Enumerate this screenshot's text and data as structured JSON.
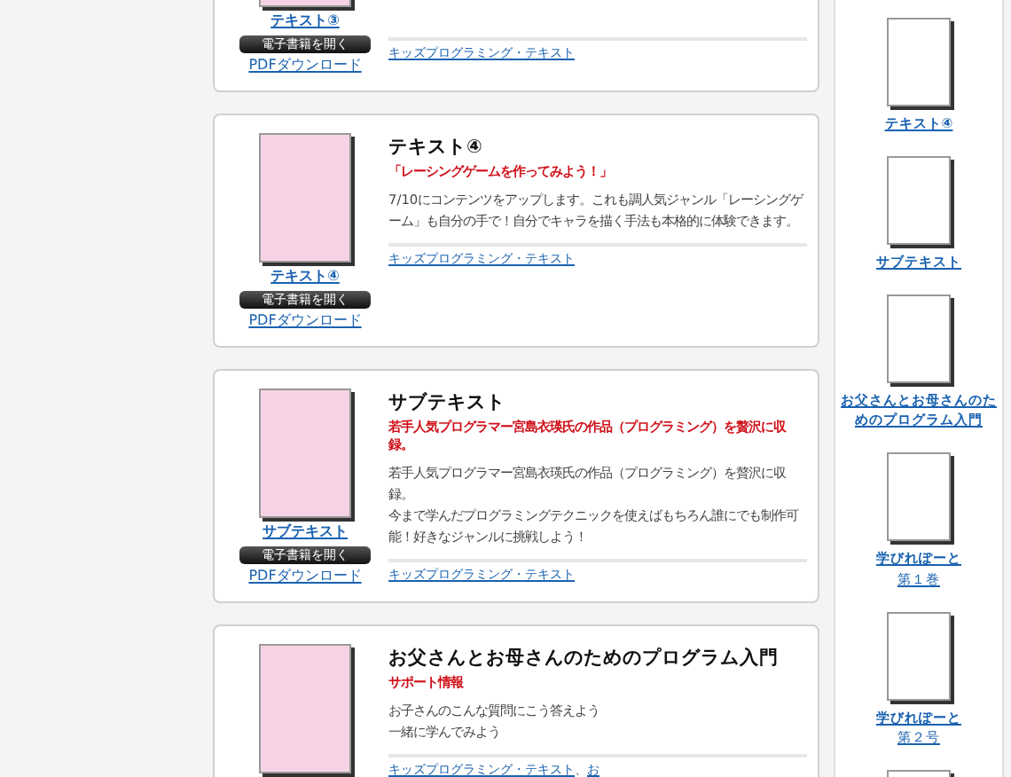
{
  "cards": [
    {
      "cover_link": "テキスト③",
      "open_button": "電子書籍を開く",
      "pdf_link": "PDFダウンロード",
      "categories": [
        "キッズプログラミング・テキスト"
      ]
    },
    {
      "title": "テキスト④",
      "subtitle": "「レーシングゲームを作ってみよう！」",
      "body": [
        "7/10にコンテンツをアップします。これも調人気ジャンル「レーシングゲーム」も自分の手で！自分でキャラを描く手法も本格的に体験できます。"
      ],
      "cover_link": "テキスト④",
      "open_button": "電子書籍を開く",
      "pdf_link": "PDFダウンロード",
      "categories": [
        "キッズプログラミング・テキスト"
      ]
    },
    {
      "title": "サブテキスト",
      "subtitle": "若手人気プログラマー宮島衣瑛氏の作品（プログラミング）を贅沢に収録。",
      "body": [
        "若手人気プログラマー宮島衣瑛氏の作品（プログラミング）を贅沢に収録。",
        "今まで学んだプログラミングテクニックを使えばもちろん誰にでも制作可能！好きなジャンルに挑戦しよう！"
      ],
      "cover_link": "サブテキスト",
      "open_button": "電子書籍を開く",
      "pdf_link": "PDFダウンロード",
      "categories": [
        "キッズプログラミング・テキスト"
      ]
    },
    {
      "title": "お父さんとお母さんのためのプログラム入門",
      "subtitle": "サポート情報",
      "body": [
        "お子さんのこんな質問にこう答えよう",
        "一緒に学んでみよう"
      ],
      "categories": [
        "キッズプログラミング・テキスト",
        "お"
      ],
      "separator": "、"
    }
  ],
  "sidebar": [
    {
      "lines": [
        "テキスト④"
      ]
    },
    {
      "lines": [
        "サブテキスト"
      ]
    },
    {
      "lines": [
        "お父さんとお母さんのためのプログラム入門"
      ]
    },
    {
      "lines": [
        "学びれぽーと",
        "第１巻"
      ]
    },
    {
      "lines": [
        "学びれぽーと",
        "第２号"
      ]
    }
  ]
}
